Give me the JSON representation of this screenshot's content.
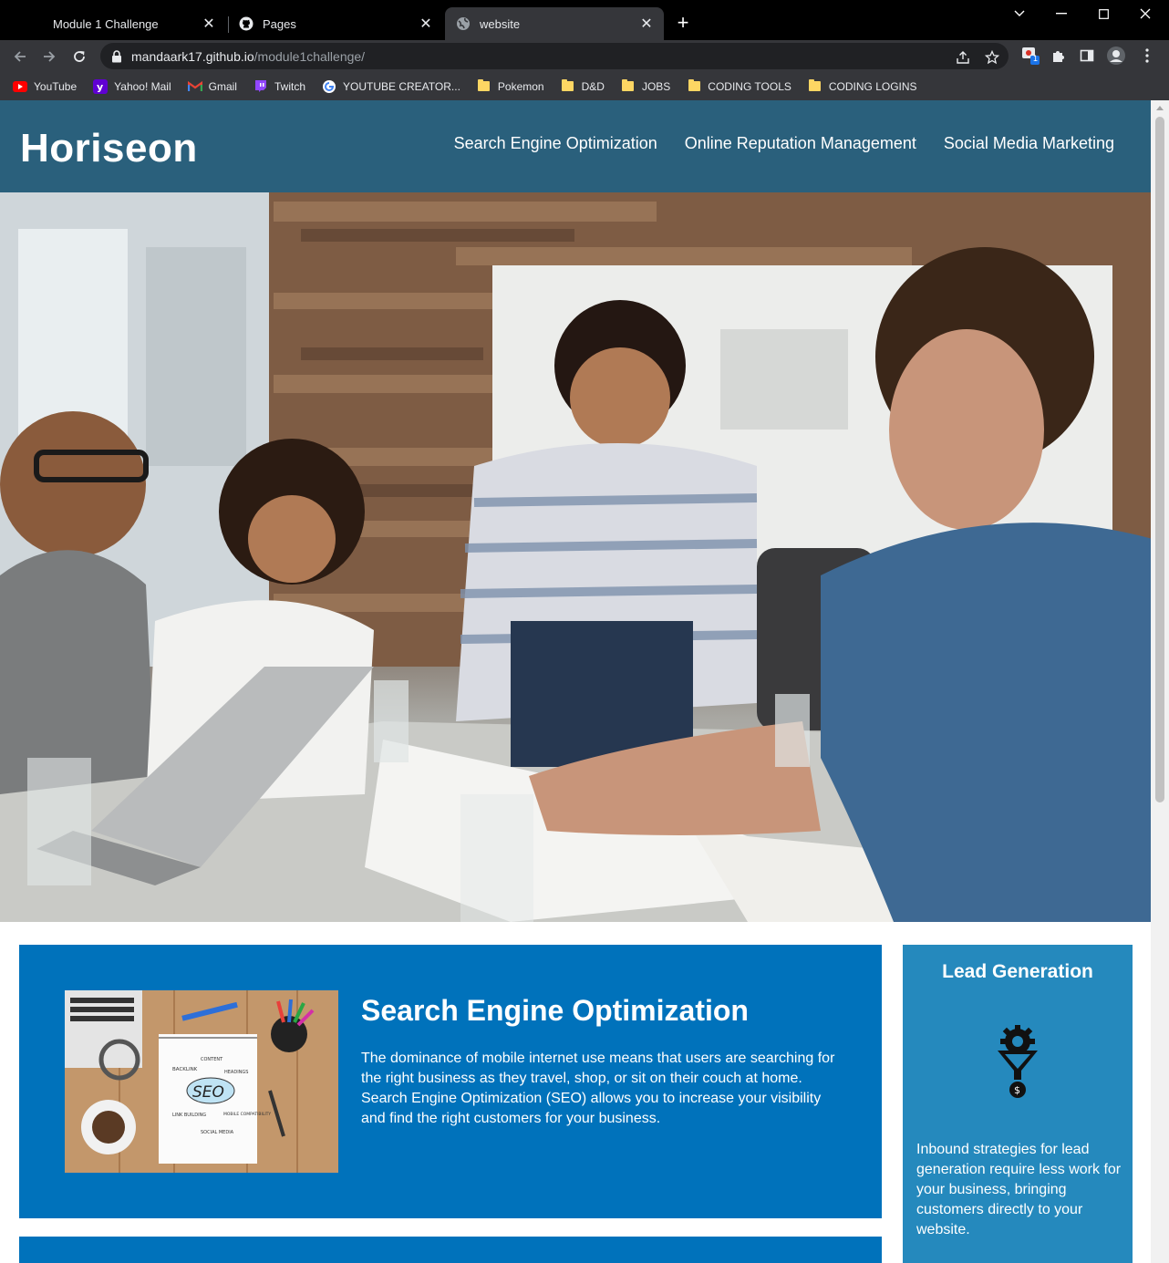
{
  "tabs": [
    {
      "label": "Module 1 Challenge",
      "icon": "page-icon"
    },
    {
      "label": "Pages",
      "icon": "github-icon"
    },
    {
      "label": "website",
      "icon": "globe-icon"
    }
  ],
  "address": {
    "host": "mandaark17.github.io",
    "path": "/module1challenge/"
  },
  "bookmarks": [
    {
      "label": "YouTube",
      "icon": "youtube-icon"
    },
    {
      "label": "Yahoo! Mail",
      "icon": "yahoo-icon"
    },
    {
      "label": "Gmail",
      "icon": "gmail-icon"
    },
    {
      "label": "Twitch",
      "icon": "twitch-icon"
    },
    {
      "label": "YOUTUBE CREATOR...",
      "icon": "google-icon"
    },
    {
      "label": "Pokemon",
      "icon": "folder-icon"
    },
    {
      "label": "D&D",
      "icon": "folder-icon"
    },
    {
      "label": "JOBS",
      "icon": "folder-icon"
    },
    {
      "label": "CODING TOOLS",
      "icon": "folder-icon"
    },
    {
      "label": "CODING LOGINS",
      "icon": "folder-icon"
    }
  ],
  "extension_badge": "1",
  "site": {
    "logo": "Horiseon",
    "nav": [
      "Search Engine Optimization",
      "Online Reputation Management",
      "Social Media Marketing"
    ]
  },
  "seo_card": {
    "title": "Search Engine Optimization",
    "body": "The dominance of mobile internet use means that users are searching for the right business as they travel, shop, or sit on their couch at home. Search Engine Optimization (SEO) allows you to increase your visibility and find the right customers for your business.",
    "image_words": [
      "CONTENT",
      "BACKLINK",
      "HEADINGS",
      "SEO",
      "LINK BUILDING",
      "MOBILE COMPATIBILITY",
      "SOCIAL MEDIA"
    ]
  },
  "lead_card": {
    "title": "Lead Generation",
    "body": "Inbound strategies for lead generation require less work for your business, bringing customers directly to your website."
  },
  "colors": {
    "header": "#2a607c",
    "card": "#0072bb",
    "aside": "#2589bd"
  }
}
